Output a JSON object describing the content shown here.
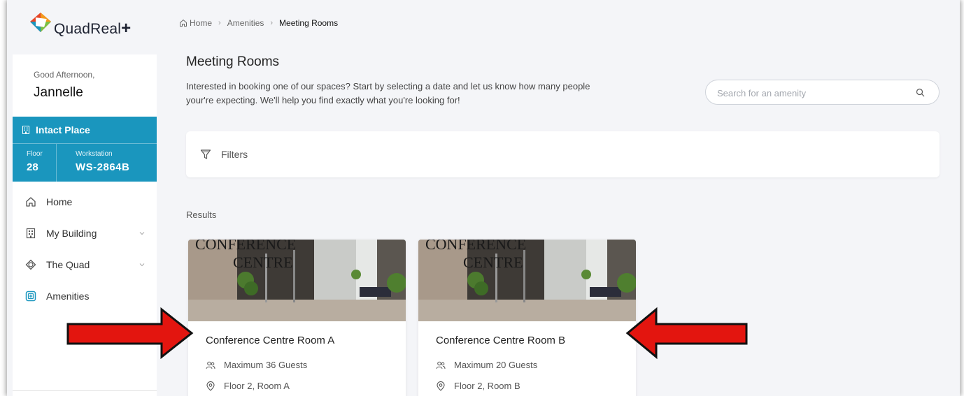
{
  "brand": {
    "name": "QuadReal",
    "plus": "+"
  },
  "sidebar": {
    "greeting": "Good Afternoon,",
    "user_name": "Jannelle",
    "location": {
      "building": "Intact Place",
      "floor_label": "Floor",
      "floor_value": "28",
      "workstation_label": "Workstation",
      "workstation_value": "WS-2864B"
    },
    "nav": [
      {
        "label": "Home",
        "icon": "home-icon"
      },
      {
        "label": "My Building",
        "icon": "building-icon",
        "expandable": true
      },
      {
        "label": "The Quad",
        "icon": "quad-icon",
        "expandable": true
      },
      {
        "label": "Amenities",
        "icon": "amenities-icon",
        "active_color": "#1a96be"
      }
    ]
  },
  "breadcrumb": [
    "Home",
    "Amenities",
    "Meeting Rooms"
  ],
  "page": {
    "title": "Meeting Rooms",
    "description": "Interested in booking one of our spaces? Start by selecting a date and let us know how many people your're expecting. We'll help you find exactly what you're looking for!"
  },
  "search": {
    "placeholder": "Search for an amenity",
    "value": ""
  },
  "filters": {
    "label": "Filters"
  },
  "results": {
    "label": "Results",
    "cards": [
      {
        "title": "Conference Centre Room A",
        "guests": "Maximum 36 Guests",
        "location": "Floor 2, Room A",
        "photo_text": [
          "CONFERENCE",
          "CENTRE"
        ]
      },
      {
        "title": "Conference Centre Room B",
        "guests": "Maximum 20 Guests",
        "location": "Floor 2, Room B",
        "photo_text": [
          "CONFERENCE",
          "CENTRE"
        ]
      }
    ]
  },
  "colors": {
    "accent": "#1a96be",
    "annotation_arrow": "#e3150f"
  }
}
